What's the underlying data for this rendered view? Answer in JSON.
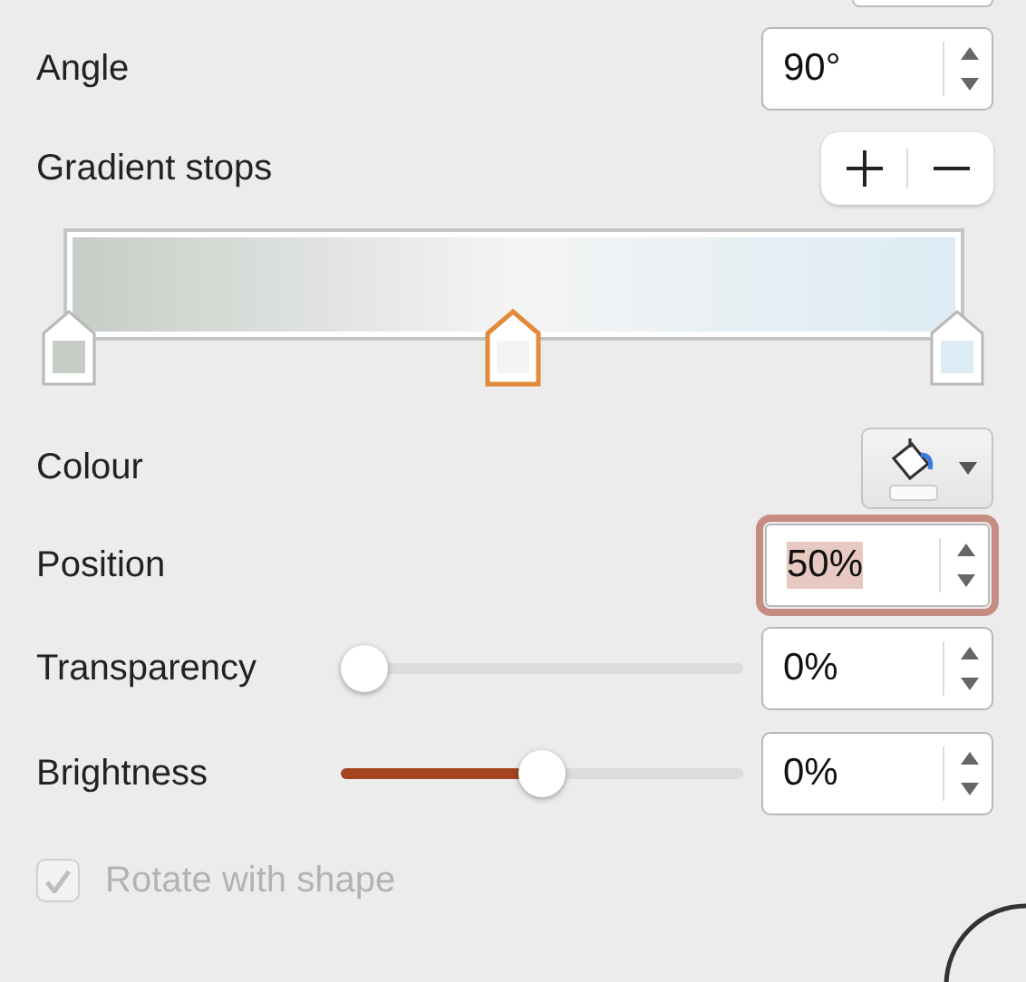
{
  "angle": {
    "label": "Angle",
    "value": "90°"
  },
  "gradient_stops": {
    "label": "Gradient stops"
  },
  "stops": [
    {
      "level": 0,
      "color": "#c6cdc6",
      "selected": false
    },
    {
      "level": 0.5,
      "color": "#f4f4f4",
      "selected": true
    },
    {
      "level": 1,
      "color": "#dcebf4",
      "selected": false
    }
  ],
  "colour": {
    "label": "Colour"
  },
  "position": {
    "label": "Position",
    "value": "50%",
    "focused": true,
    "text_selected": true
  },
  "sliders": [
    {
      "label": "Transparency",
      "level": 0,
      "value": "0%"
    },
    {
      "label": "Brightness",
      "level": 0.5,
      "value": "0%"
    }
  ],
  "rotate": {
    "label": "Rotate with shape",
    "checked": true,
    "disabled": true
  }
}
